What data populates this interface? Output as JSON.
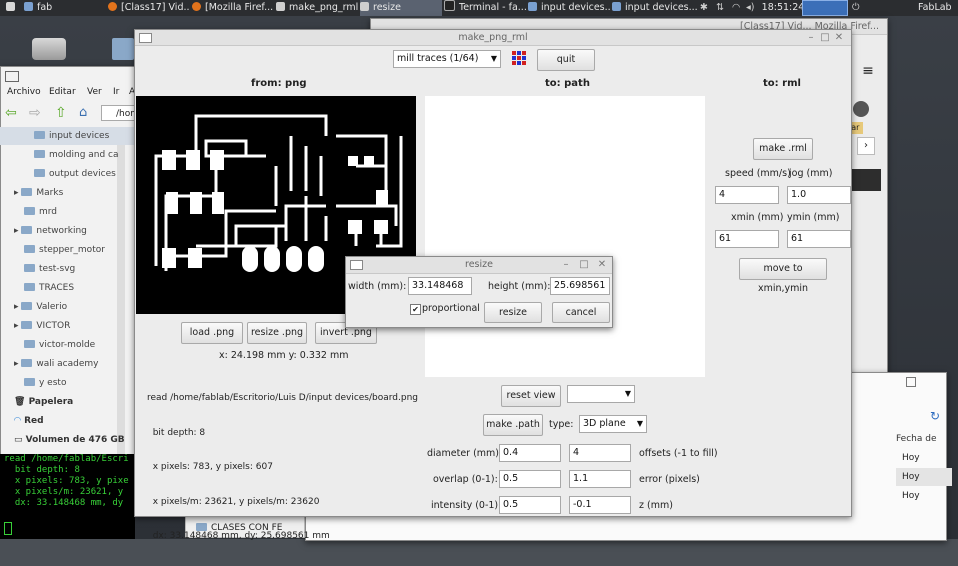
{
  "taskbar": {
    "items": [
      {
        "label": "fab"
      },
      {
        "label": "[Class17] Vid..."
      },
      {
        "label": "[Mozilla Firef..."
      },
      {
        "label": "make_png_rml"
      },
      {
        "label": "resize"
      },
      {
        "label": "Terminal - fa..."
      },
      {
        "label": "input devices..."
      },
      {
        "label": "input devices..."
      }
    ],
    "clock": "18:51:24",
    "user": "FabLab"
  },
  "file_manager": {
    "menu": [
      "Archivo",
      "Editar",
      "Ver",
      "Ir",
      "A"
    ],
    "path": "/hom",
    "items": [
      "input devices",
      "molding and ca",
      "output devices",
      "Marks",
      "mrd",
      "networking",
      "stepper_motor",
      "test-svg",
      "TRACES",
      "Valerio",
      "VICTOR",
      "victor-molde",
      "wali academy",
      "y esto"
    ],
    "places": [
      "Papelera",
      "Red",
      "Volumen de 476 GB"
    ]
  },
  "terminal": {
    "lines": [
      "read /home/fablab/Escri",
      "  bit depth: 8",
      "  x pixels: 783, y pixe",
      "  x pixels/m: 23621, y",
      "  dx: 33.148468 mm, dy"
    ]
  },
  "back_browser": {
    "title": "[Class17] Vid... Mozilla Firef...",
    "badge": "lar"
  },
  "back_fm2": {
    "col_header": "Fecha de",
    "rows": [
      "Hoy",
      "Hoy",
      "Hoy"
    ],
    "folder": "CLASES CON FE"
  },
  "main": {
    "title": "make_png_rml",
    "mode_select": "mill traces (1/64)",
    "quit_label": "quit",
    "from_header": "from: png",
    "to_path_header": "to: path",
    "to_rml_header": "to: rml",
    "load_label": "load .png",
    "resize_label": "resize .png",
    "invert_label": "invert .png",
    "coords": "x: 24.198 mm  y: 0.332 mm",
    "info": [
      "read /home/fablab/Escritorio/Luis D/input devices/board.png",
      "  bit depth: 8",
      "  x pixels: 783, y pixels: 607",
      "  x pixels/m: 23621, y pixels/m: 23620",
      "  dx: 33.148468 mm, dy: 25.698561 mm"
    ],
    "reset_view_label": "reset view",
    "make_path_label": "make .path",
    "type_label": "type:",
    "type_value": "3D plane",
    "diameter_label": "diameter (mm):",
    "diameter_value": "0.4",
    "offsets_value": "4",
    "offsets_label": "offsets (-1 to fill)",
    "overlap_label": "overlap (0-1):",
    "overlap_value": "0.5",
    "error_value": "1.1",
    "error_label": "error (pixels)",
    "intensity_label": "intensity (0-1):",
    "intensity_value": "0.5",
    "z_value": "-0.1",
    "z_label": "z (mm)",
    "make_rml_label": "make .rml",
    "speed_label": "speed (mm/s)",
    "jog_label": "jog (mm)",
    "speed_value": "4",
    "jog_value": "1.0",
    "xmin_label": "xmin (mm)",
    "ymin_label": "ymin (mm)",
    "xmin_value": "61",
    "ymin_value": "61",
    "move_label": "move to xmin,ymin"
  },
  "resize_dialog": {
    "title": "resize",
    "width_label": "width (mm):",
    "width_value": "33.148468",
    "height_label": "height (mm):",
    "height_value": "25.698561",
    "proportional_label": "proportional",
    "resize_label": "resize",
    "cancel_label": "cancel"
  },
  "colors": {
    "taskbar": "#2b2d30",
    "window_bg": "#ececec",
    "terminal_text": "#38d038",
    "accent": "#2d6cc0"
  }
}
